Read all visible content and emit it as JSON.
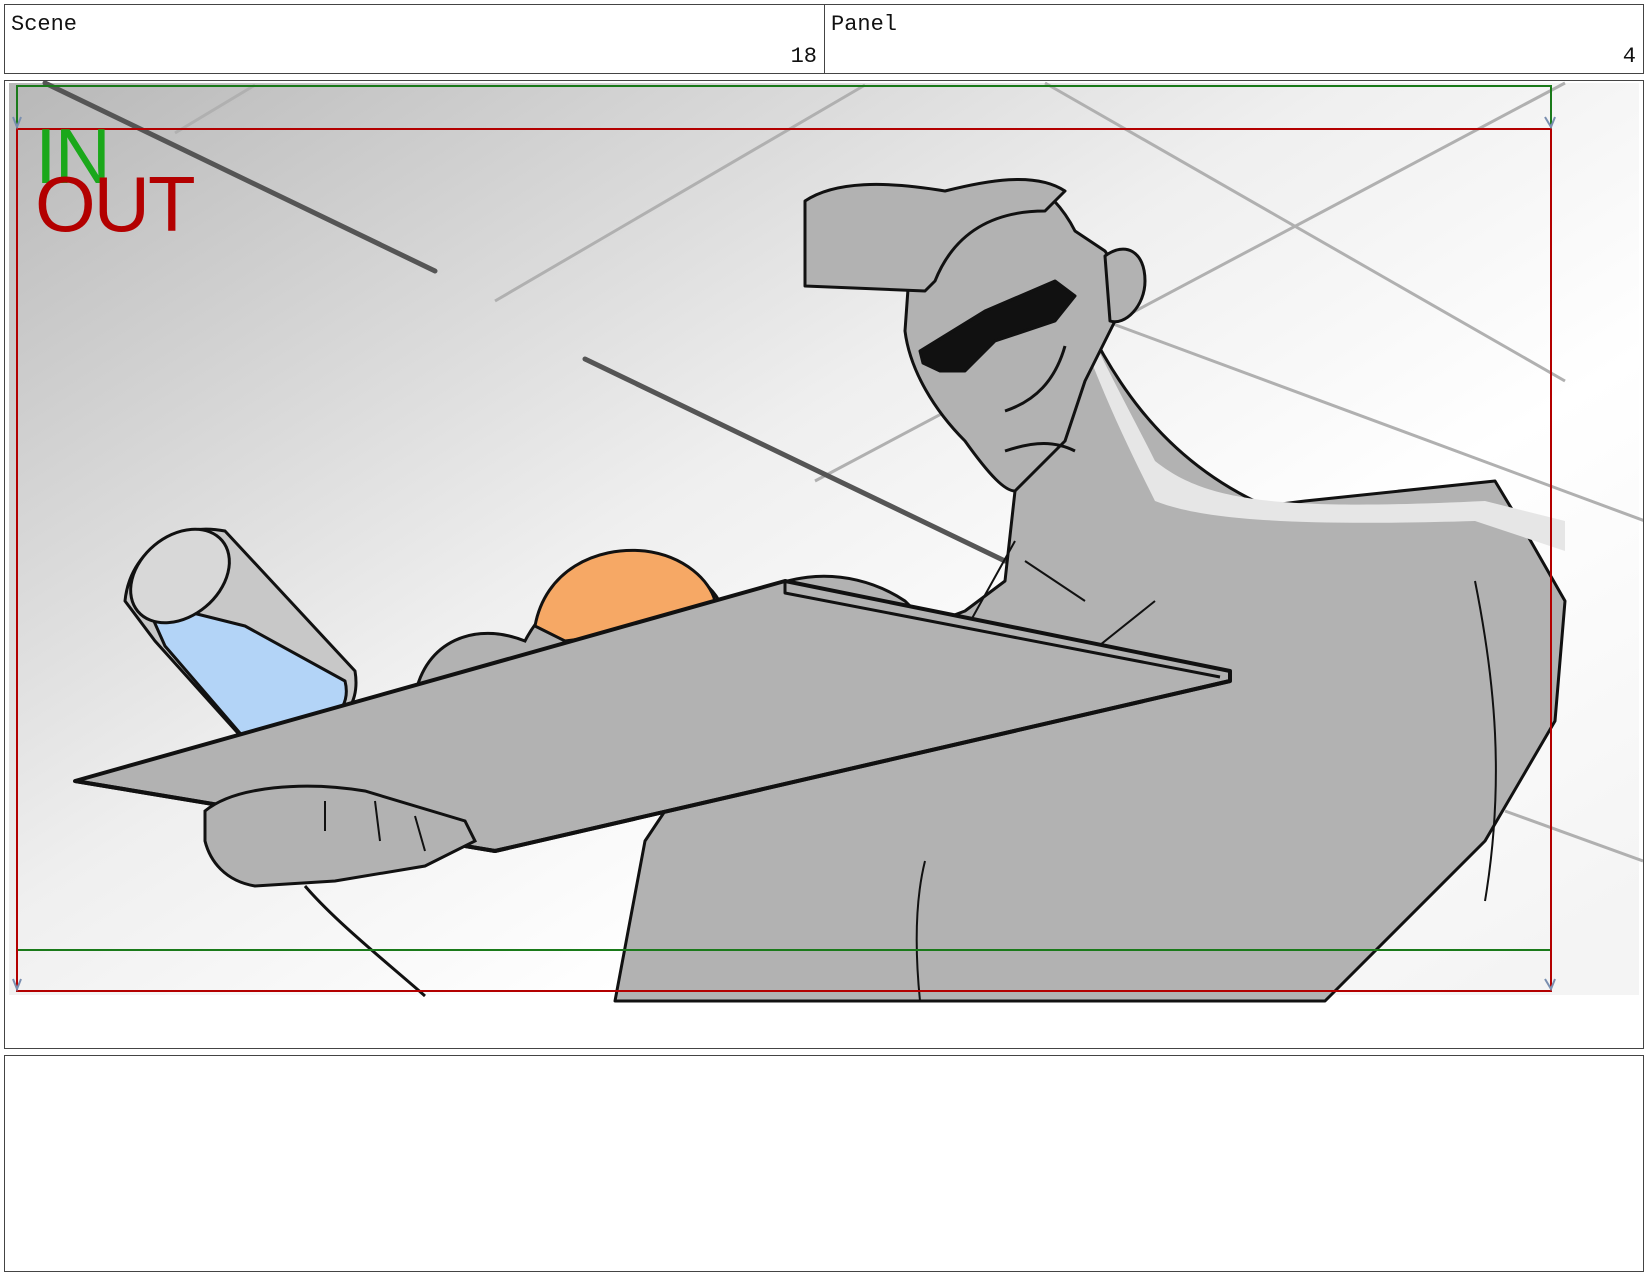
{
  "header": {
    "scene_label": "Scene",
    "scene_value": "18",
    "panel_label": "Panel",
    "panel_value": "4"
  },
  "frame": {
    "in_label": "IN",
    "out_label": "OUT"
  },
  "notes": {
    "text": ""
  },
  "colors": {
    "in_guide": "#1a7a1a",
    "out_guide": "#b30000",
    "in_text": "#1aa81a",
    "out_text": "#b30000",
    "water": "#b3d4f7",
    "orange": "#f6a865",
    "figure_gray": "#b2b2b2"
  }
}
